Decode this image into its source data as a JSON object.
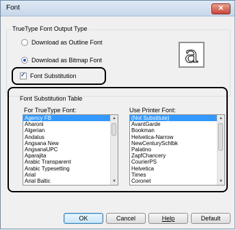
{
  "window": {
    "title": "Font",
    "close_glyph": "✕"
  },
  "output_type": {
    "group_label": "TrueType Font Output Type",
    "options": [
      {
        "label": "Download as Outline Font",
        "selected": false
      },
      {
        "label": "Download as Bitmap Font",
        "selected": true
      }
    ],
    "preview_glyph": "a"
  },
  "substitution": {
    "label": "Font Substitution",
    "checked": true
  },
  "table": {
    "group_label": "Font Substitution Table",
    "truetype_label": "For TrueType Font:",
    "printer_label": "Use Printer Font:",
    "truetype_fonts": [
      "Agency FB",
      "Aharoni",
      "Algerian",
      "Andalus",
      "Angsana New",
      "AngsanaUPC",
      "Aparajita",
      "Arabic Transparent",
      "Arabic Typesetting",
      "Arial",
      "Arial Baltic"
    ],
    "printer_fonts": [
      "(Not Substitute)",
      "AvantGarde",
      "Bookman",
      "Helvetica-Narrow",
      "NewCenturySchlbk",
      "Palatino",
      "ZapfChancery",
      "CourierPS",
      "Helvetica",
      "Times",
      "Coronet"
    ]
  },
  "buttons": {
    "ok": "OK",
    "cancel": "Cancel",
    "help": "Help",
    "default": "Default"
  },
  "colors": {
    "selection": "#3399ff",
    "highlight_border": "#000000"
  }
}
